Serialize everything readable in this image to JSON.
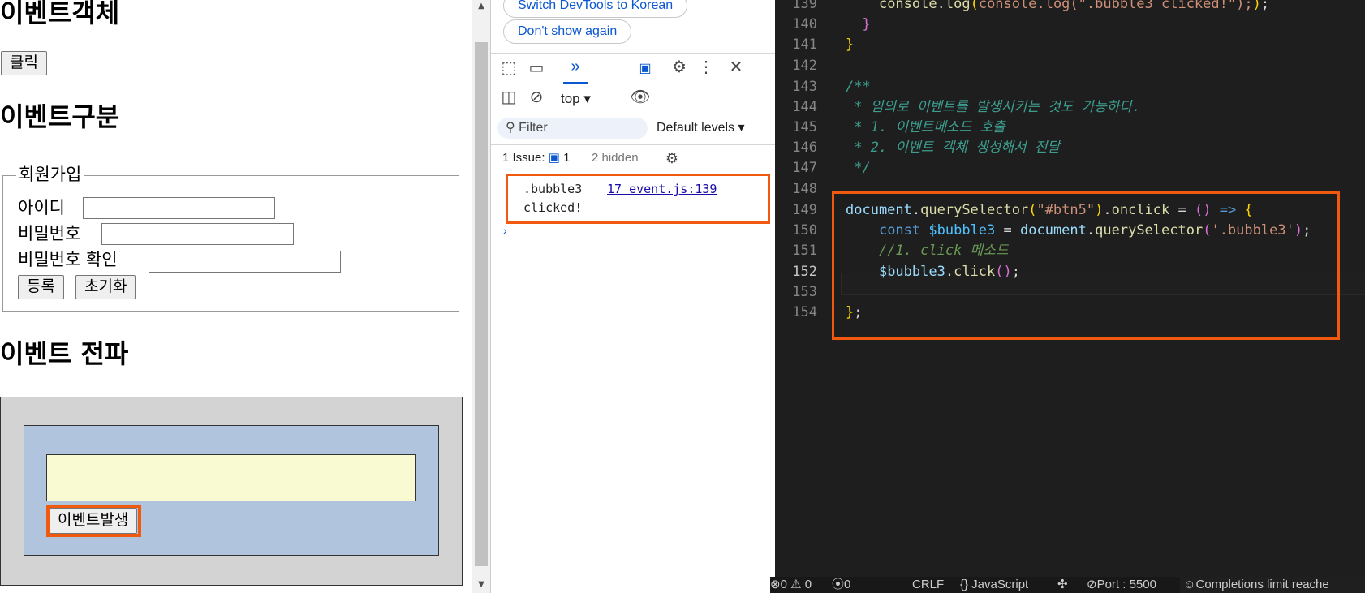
{
  "page": {
    "heading_event_object": "이벤트객체",
    "click_button": "클릭",
    "heading_event_types": "이벤트구분",
    "signup_legend": "회원가입",
    "id_label": "아이디",
    "password_label": "비밀번호",
    "password_confirm_label": "비밀번호 확인",
    "register_button": "등록",
    "reset_button": "초기화",
    "heading_propagation": "이벤트 전파",
    "fire_event_button": "이벤트발생"
  },
  "devtools": {
    "switch_language": "Switch DevTools to Korean",
    "dont_show": "Don't show again",
    "context": "top",
    "filter_placeholder": "Filter",
    "levels": "Default levels",
    "issues_label": "1 Issue:",
    "issues_count": "1",
    "hidden_count": "2 hidden",
    "console_message_line1": ".bubble3",
    "console_message_line2": "clicked!",
    "console_source": "17_event.js:139"
  },
  "editor": {
    "line_numbers": [
      "139",
      "140",
      "141",
      "142",
      "143",
      "144",
      "145",
      "146",
      "147",
      "148",
      "149",
      "150",
      "151",
      "152",
      "153",
      "154"
    ],
    "active_line": "152",
    "line139": "console.log(\".bubble3 clicked!\");",
    "comment1": "/**",
    "comment2": " * 임의로 이벤트를 발생시키는 것도 가능하다.",
    "comment3": " * 1. 이벤트메소드 호출",
    "comment4": " * 2. 이벤트 객체 생성해서 전달",
    "comment5": " */",
    "line151": "//1. click 메소드"
  },
  "statusbar": {
    "problems": "0 ⚠ 0",
    "ports_count": "0",
    "eol": "CRLF",
    "language": "{} JavaScript",
    "port": "Port : 5500",
    "completions": "Completions limit reache"
  },
  "colors": {
    "highlight": "#f0590e",
    "editor_bg": "#1e1e1e",
    "middle_box": "#b0c4de",
    "inner_box": "#fafad2",
    "outer_box": "#d3d3d3"
  }
}
